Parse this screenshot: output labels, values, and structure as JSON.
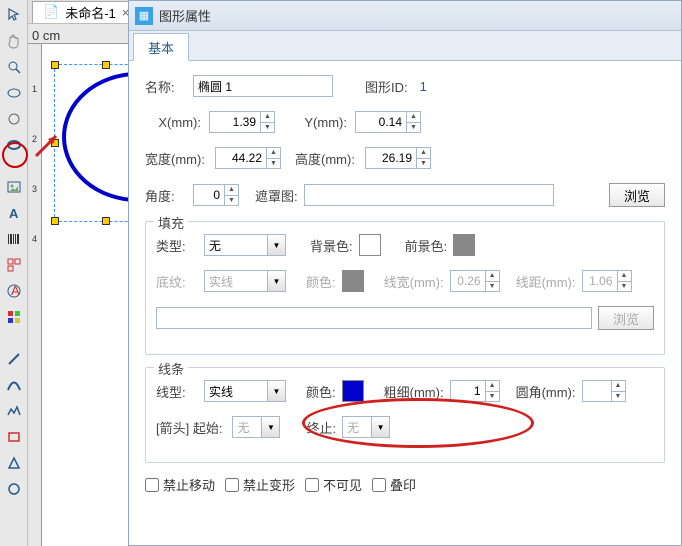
{
  "doc_tab": {
    "title": "未命名-1",
    "close": "×"
  },
  "ruler": {
    "zero": "0 cm",
    "v1": "1",
    "v2": "2",
    "v3": "3",
    "v4": "4"
  },
  "panel": {
    "header": "图形属性",
    "tab_basic": "基本",
    "name_label": "名称:",
    "name_value": "椭圆 1",
    "shapeid_label": "图形ID:",
    "shapeid_value": "1",
    "x_label": "X(mm):",
    "x_value": "1.39",
    "y_label": "Y(mm):",
    "y_value": "0.14",
    "w_label": "宽度(mm):",
    "w_value": "44.22",
    "h_label": "高度(mm):",
    "h_value": "26.19",
    "angle_label": "角度:",
    "angle_value": "0",
    "mask_label": "遮罩图:",
    "browse": "浏览",
    "fill": {
      "title": "填充",
      "type_label": "类型:",
      "type_value": "无",
      "bgcolor_label": "背景色:",
      "fgcolor_label": "前景色:",
      "pattern_label": "底纹:",
      "pattern_value": "实线",
      "color_label": "颜色:",
      "linew_label": "线宽(mm):",
      "linew_value": "0.26",
      "linesp_label": "线距(mm):",
      "linesp_value": "1.06",
      "browse": "浏览"
    },
    "line": {
      "title": "线条",
      "type_label": "线型:",
      "type_value": "实线",
      "color_label": "颜色:",
      "weight_label": "粗细(mm):",
      "weight_value": "1",
      "corner_label": "圆角(mm):",
      "arrow_label": "[箭头] 起始:",
      "arrow_start": "无",
      "end_label": "终止:",
      "arrow_end": "无"
    },
    "checks": {
      "lockmove": "禁止移动",
      "lockdeform": "禁止变形",
      "invisible": "不可见",
      "overprint": "叠印"
    }
  },
  "colors": {
    "fg_swatch": "#888888",
    "bg_swatch": "#ffffff",
    "fill_color_swatch": "#888888",
    "line_color": "#0000cc"
  }
}
